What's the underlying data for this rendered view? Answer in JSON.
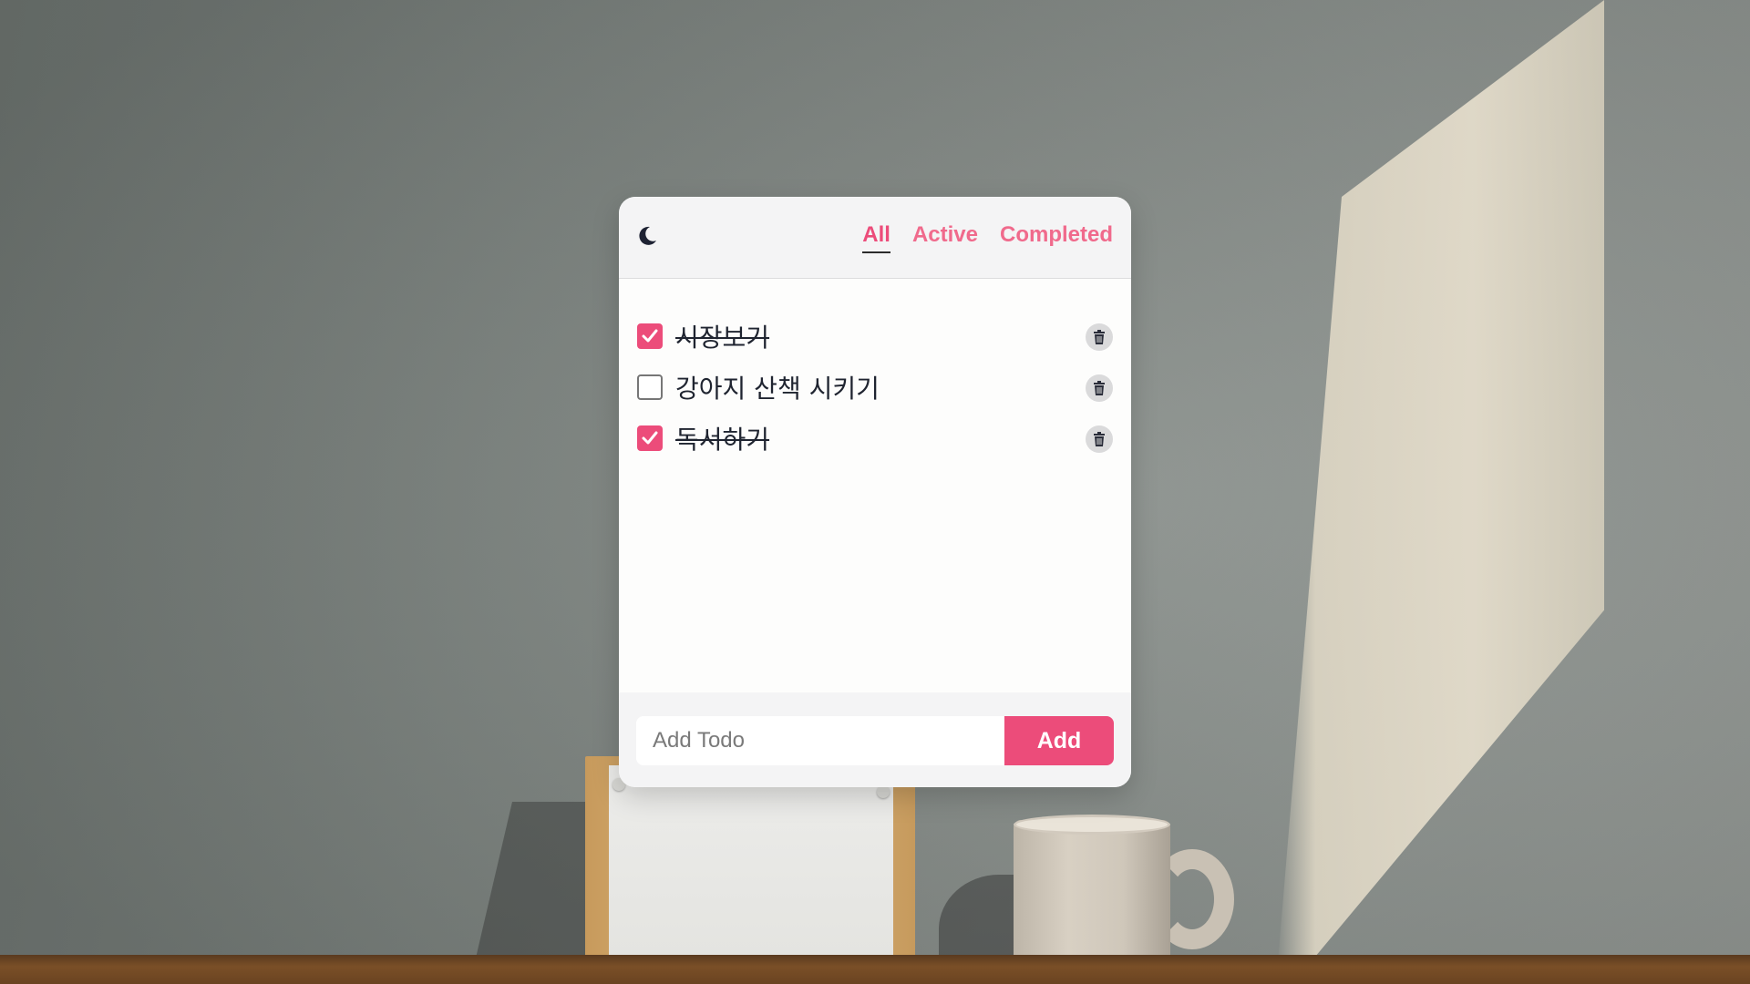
{
  "header": {
    "theme_toggle_icon": "moon-icon",
    "filters": [
      {
        "label": "All",
        "selected": true
      },
      {
        "label": "Active",
        "selected": false
      },
      {
        "label": "Completed",
        "selected": false
      }
    ]
  },
  "todos": [
    {
      "text": "시장보기",
      "completed": true,
      "delete_icon": "trash-icon"
    },
    {
      "text": "강아지 산책 시키기",
      "completed": false,
      "delete_icon": "trash-icon"
    },
    {
      "text": "독서하기",
      "completed": true,
      "delete_icon": "trash-icon"
    }
  ],
  "form": {
    "placeholder": "Add Todo",
    "value": "",
    "add_label": "Add"
  },
  "colors": {
    "accent": "#ec4c7a",
    "header_bg": "#f4f4f5",
    "text": "#1f2430"
  }
}
